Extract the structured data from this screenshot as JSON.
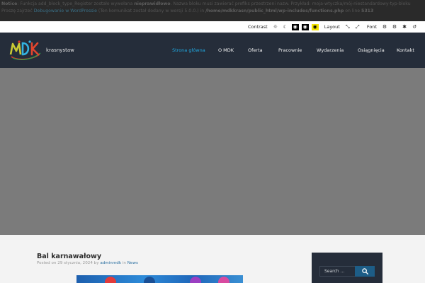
{
  "notice": {
    "label": "Notice",
    "segments": [
      {
        "t": "Notice",
        "k": "b"
      },
      {
        "t": ": Funkcja add_block_type_Register zostało wywołana ",
        "k": "n"
      },
      {
        "t": "nieprawidłowo",
        "k": "b"
      },
      {
        "t": ". Nazwa bloku musi zawierać prefiks przestrzeni nazw. Przykład: moja-wtyczka/mój-niestandardowy-typ-bloku Proszę zajrzeć ",
        "k": "n"
      },
      {
        "t": "Debugowanie w WordPressie",
        "k": "a"
      },
      {
        "t": " (Ten komunikat został dodany w wersji 5.0.0.) in ",
        "k": "n"
      },
      {
        "t": "/home/mdkkrasn/public_html/wp-includes/functions.php",
        "k": "b"
      },
      {
        "t": " on line ",
        "k": "n"
      },
      {
        "t": "5313",
        "k": "b"
      }
    ]
  },
  "a11y": {
    "contrast_label": "Contrast",
    "layout_label": "Layout",
    "font_label": "Font"
  },
  "header": {
    "brand": "MDK",
    "brand_sub": "krasnystaw",
    "nav": [
      {
        "label": "Strona główna",
        "active": true
      },
      {
        "label": "O MDK",
        "active": false
      },
      {
        "label": "Oferta",
        "active": false
      },
      {
        "label": "Pracownie",
        "active": false
      },
      {
        "label": "Wydarzenia",
        "active": false
      },
      {
        "label": "Osiągnięcia",
        "active": false
      },
      {
        "label": "Kontakt",
        "active": false
      }
    ]
  },
  "post": {
    "title": "Bal karnawałowy",
    "meta_posted": "Posted on ",
    "date": "29 stycznia, 2024",
    "meta_by": " by ",
    "author": "adminmdk",
    "meta_in": " in ",
    "category": "News"
  },
  "sidebar": {
    "search_placeholder": "Search ..."
  },
  "colors": {
    "header_bg": "#252d3a",
    "nav_active": "#20a8e0",
    "hero_bg": "#7b7b7b",
    "search_button": "#1d5d87"
  }
}
